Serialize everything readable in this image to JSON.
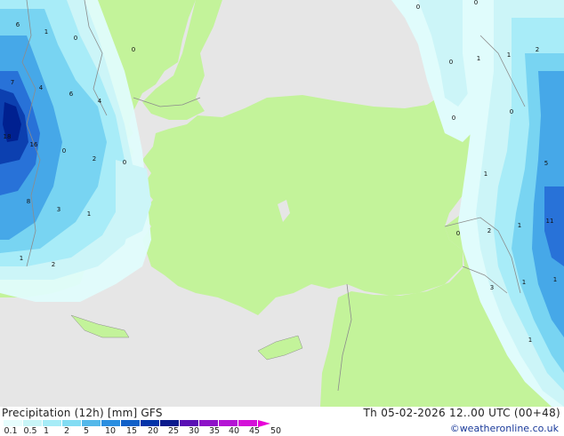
{
  "map": {
    "colors": {
      "land": "#c3f39a",
      "sea": "#e6e6e6",
      "p01": "#e0fcfc",
      "p05": "#ccf5f8",
      "p1": "#a8ecf8",
      "p2": "#78d4f2",
      "p5": "#46a8e8",
      "p10": "#2872d8",
      "p15": "#0c40b0",
      "p20": "#002090",
      "border": "#8c8c8c"
    },
    "labels": [
      "6",
      "1",
      "0",
      "0",
      "0",
      "0",
      "1",
      "1",
      "2",
      "7",
      "4",
      "6",
      "4",
      "18",
      "16",
      "0",
      "2",
      "0",
      "0",
      "0",
      "8",
      "3",
      "1",
      "1",
      "2",
      "1",
      "5",
      "0",
      "2",
      "0",
      "11",
      "1",
      "3",
      "1",
      "1",
      "1"
    ]
  },
  "footer": {
    "title": "Precipitation (12h) [mm] GFS",
    "valid": "Th 05-02-2026 12..00 UTC (00+48)",
    "copyright": "©weatheronline.co.uk",
    "legend_colors": [
      "#e6fdfd",
      "#c8f5f7",
      "#a6ecf7",
      "#82dcf3",
      "#54b8ea",
      "#2a8ee0",
      "#1060c8",
      "#0434a8",
      "#0b1b8c",
      "#5a10b4",
      "#8e12c8",
      "#b414d4",
      "#d412d8",
      "#e800d8"
    ],
    "legend_ticks": [
      "0.1",
      "0.5",
      "1",
      "2",
      "5",
      "10",
      "15",
      "20",
      "25",
      "30",
      "35",
      "40",
      "45",
      "50"
    ]
  }
}
